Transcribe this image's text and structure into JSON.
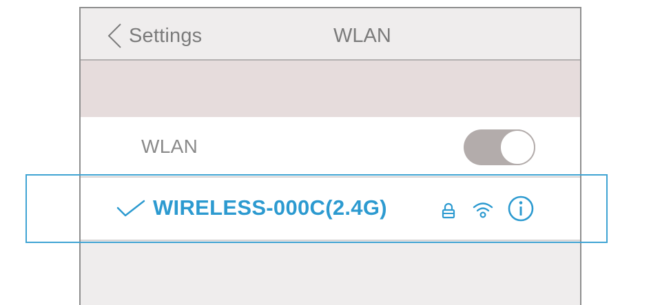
{
  "navbar": {
    "back_label": "Settings",
    "title": "WLAN"
  },
  "wlan": {
    "label": "WLAN",
    "toggle_on": true
  },
  "network": {
    "name": "WIRELESS-000C(2.4G)",
    "connected": true,
    "secured": true,
    "icons": [
      "checkmark-icon",
      "lock-icon",
      "wifi-signal-icon",
      "info-icon"
    ]
  },
  "colors": {
    "accent": "#2c9ad0",
    "highlight_border": "#3ea3d3",
    "toggle_track": "#b3acab",
    "navbar_bg": "#efeded",
    "band_bg": "#e6dcdc"
  }
}
